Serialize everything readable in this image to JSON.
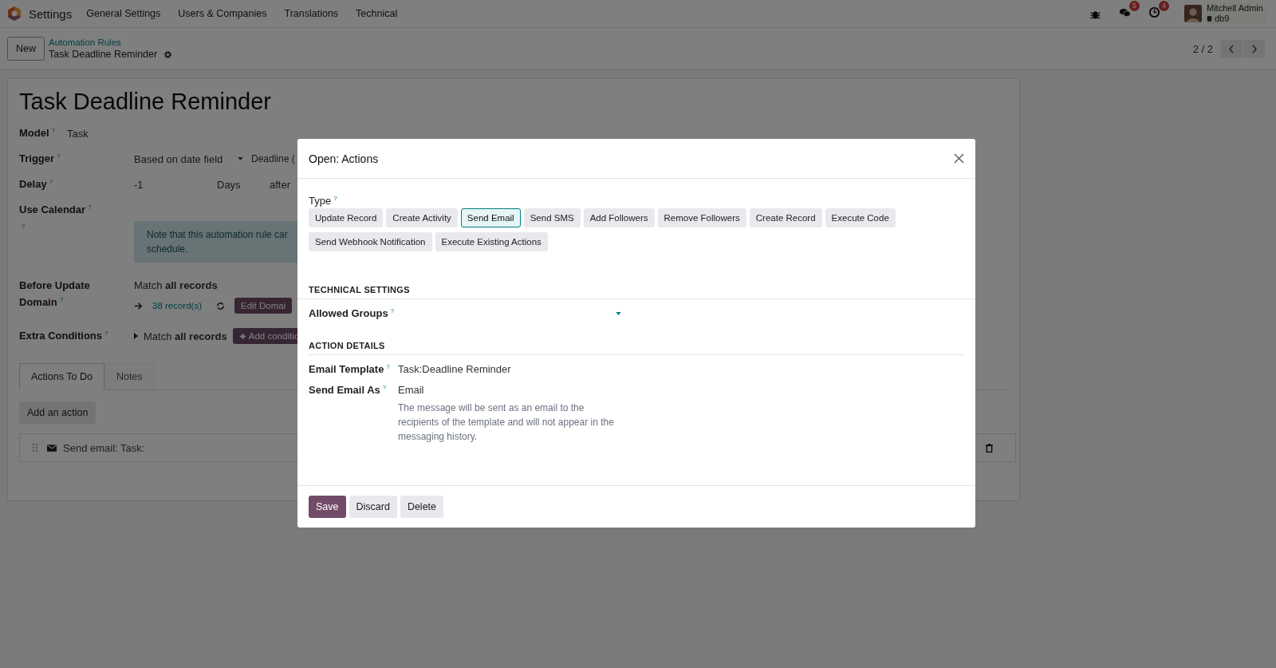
{
  "navbar": {
    "app_name": "Settings",
    "menus": [
      "General Settings",
      "Users & Companies",
      "Translations",
      "Technical"
    ],
    "messages_badge": "5",
    "activities_badge": "4",
    "user_name": "Mitchell Admin",
    "database": "db9"
  },
  "control_panel": {
    "new_button": "New",
    "breadcrumb": "Automation Rules",
    "current": "Task Deadline Reminder",
    "pager": "2 / 2"
  },
  "form": {
    "title": "Task Deadline Reminder",
    "model": {
      "label": "Model",
      "help": "?",
      "value": "Task"
    },
    "trigger": {
      "label": "Trigger",
      "help": "?",
      "value": "Based on date field",
      "date_field": "Deadline ("
    },
    "delay": {
      "label": "Delay",
      "help": "?",
      "value": "-1",
      "unit": "Days",
      "when": "after"
    },
    "use_calendar": {
      "label": "Use Calendar",
      "help": "?"
    },
    "note": {
      "help": "?",
      "lines": [
        "Note that this automation rule car",
        "schedule."
      ]
    },
    "before_update": {
      "label_lines": [
        "Before Update",
        "Domain"
      ],
      "help": "?",
      "match": "Match **all records**",
      "records": "38 record(s)",
      "button": "Edit Domai"
    },
    "extra_conditions": {
      "label": "Extra Conditions",
      "help": "?",
      "match": "Match **all records**",
      "button": "Add conditio"
    },
    "tabs": [
      {
        "label": "Actions To Do",
        "selected": true
      },
      {
        "label": "Notes",
        "selected": false
      }
    ],
    "add_action": "Add an action",
    "actions": [
      {
        "label": "Send email: Task:"
      }
    ]
  },
  "dialog": {
    "title": "Open: Actions",
    "type_label": "Type",
    "type_help": "?",
    "types": [
      {
        "label": "Update Record",
        "selected": false
      },
      {
        "label": "Create Activity",
        "selected": false
      },
      {
        "label": "Send Email",
        "selected": true
      },
      {
        "label": "Send SMS",
        "selected": false
      },
      {
        "label": "Add Followers",
        "selected": false
      },
      {
        "label": "Remove Followers",
        "selected": false
      },
      {
        "label": "Create Record",
        "selected": false
      },
      {
        "label": "Execute Code",
        "selected": false
      },
      {
        "label": "Send Webhook Notification",
        "selected": false
      },
      {
        "label": "Execute Existing Actions",
        "selected": false
      }
    ],
    "technical_heading": "TECHNICAL SETTINGS",
    "allowed_groups": {
      "label": "Allowed Groups",
      "help": "?"
    },
    "details_heading": "ACTION DETAILS",
    "email_template": {
      "label": "Email Template",
      "help": "?",
      "value": "Task:Deadline Reminder"
    },
    "send_as": {
      "label": "Send Email As",
      "help": "?",
      "value": "Email",
      "description": "The message will be sent as an email to the recipients of the template and will not appear in the messaging history."
    },
    "buttons": [
      {
        "label": "Save",
        "kind": "primary"
      },
      {
        "label": "Discard",
        "kind": "secondary"
      },
      {
        "label": "Delete",
        "kind": "secondary"
      }
    ]
  }
}
